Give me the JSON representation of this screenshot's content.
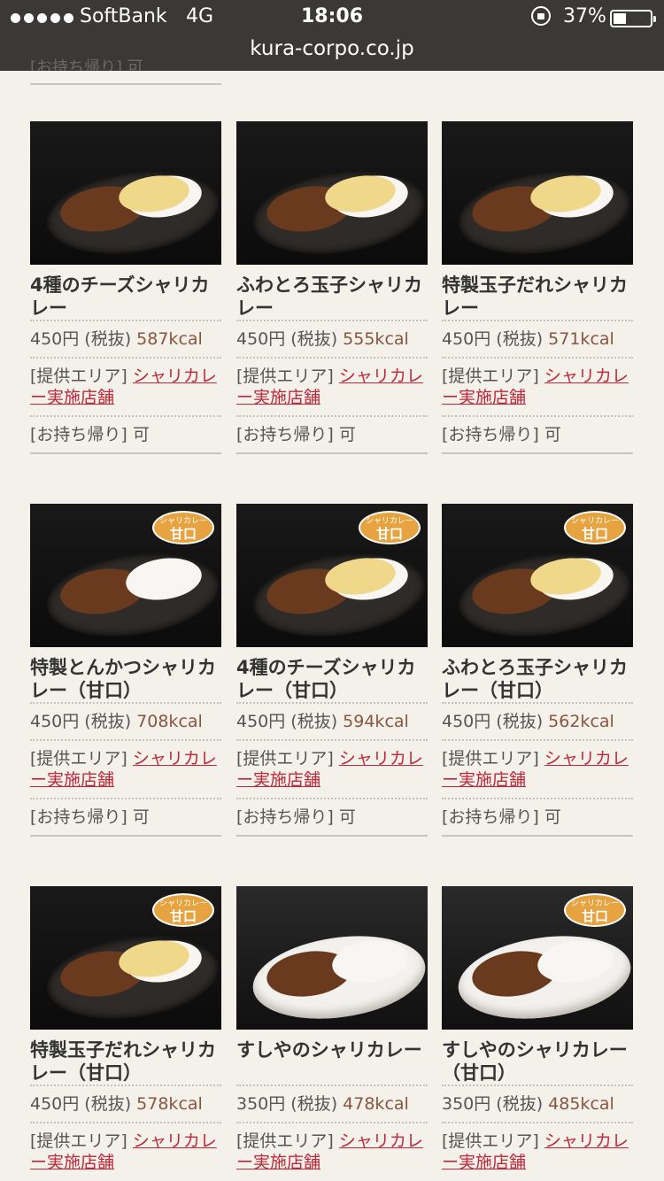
{
  "status": {
    "carrier": "SoftBank",
    "network": "4G",
    "time": "18:06",
    "battery": "37%",
    "url": "kura-corpo.co.jp"
  },
  "items": [
    {
      "name": "4種のチーズシャリカレー",
      "price": "450円 (税抜)",
      "kcal": "587kcal",
      "area_label": "[提供エリア]",
      "area_link": "シャリカレー実施店舗",
      "takeout": "[お持ち帰り] 可",
      "badge": ""
    },
    {
      "name": "ふわとろ玉子シャリカレー",
      "price": "450円 (税抜)",
      "kcal": "555kcal",
      "area_label": "[提供エリア]",
      "area_link": "シャリカレー実施店舗",
      "takeout": "[お持ち帰り] 可",
      "badge": ""
    },
    {
      "name": "特製玉子だれシャリカレー",
      "price": "450円 (税抜)",
      "kcal": "571kcal",
      "area_label": "[提供エリア]",
      "area_link": "シャリカレー実施店舗",
      "takeout": "[お持ち帰り] 可",
      "badge": ""
    },
    {
      "name": "特製とんかつシャリカレー（甘口）",
      "price": "450円 (税抜)",
      "kcal": "708kcal",
      "area_label": "[提供エリア]",
      "area_link": "シャリカレー実施店舗",
      "takeout": "[お持ち帰り] 可",
      "badge": "甘口"
    },
    {
      "name": "4種のチーズシャリカレー（甘口）",
      "price": "450円 (税抜)",
      "kcal": "594kcal",
      "area_label": "[提供エリア]",
      "area_link": "シャリカレー実施店舗",
      "takeout": "[お持ち帰り] 可",
      "badge": "甘口"
    },
    {
      "name": "ふわとろ玉子シャリカレー（甘口）",
      "price": "450円 (税抜)",
      "kcal": "562kcal",
      "area_label": "[提供エリア]",
      "area_link": "シャリカレー実施店舗",
      "takeout": "[お持ち帰り] 可",
      "badge": "甘口"
    },
    {
      "name": "特製玉子だれシャリカレー（甘口）",
      "price": "450円 (税抜)",
      "kcal": "578kcal",
      "area_label": "[提供エリア]",
      "area_link": "シャリカレー実施店舗",
      "takeout": "",
      "badge": "甘口"
    },
    {
      "name": "すしやのシャリカレー",
      "price": "350円 (税抜)",
      "kcal": "478kcal",
      "area_label": "[提供エリア]",
      "area_link": "シャリカレー実施店舗",
      "takeout": "",
      "badge": ""
    },
    {
      "name": "すしやのシャリカレー（甘口）",
      "price": "350円 (税抜)",
      "kcal": "485kcal",
      "area_label": "[提供エリア]",
      "area_link": "シャリカレー実施店舗",
      "takeout": "",
      "badge": "甘口"
    }
  ],
  "badge_top": "シャリカレー"
}
